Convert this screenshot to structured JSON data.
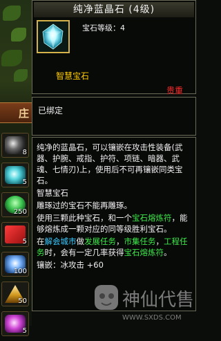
{
  "colors": {
    "title_bg": "#2a2a22",
    "border": "#6b6b5a",
    "gold_label": "#ffcc00",
    "rarity_red": "#ff2a2a",
    "highlight_green": "#3ee84a",
    "warning_red": "#ff3030",
    "link_cyan": "#37c9ff"
  },
  "left_panel": {
    "tab_label": "庄",
    "slots": [
      {
        "icon": "black-crystal-icon",
        "count": "8"
      },
      {
        "icon": "cyan-crystal-icon",
        "count": "5"
      },
      {
        "icon": "green-jade-icon",
        "count": "250"
      },
      {
        "icon": "red-box-icon",
        "count": "5"
      },
      {
        "icon": "blue-gem-icon",
        "count": "100"
      },
      {
        "icon": "gold-pyramid-icon",
        "count": "50"
      },
      {
        "icon": "magenta-crystal-icon",
        "count": "5"
      }
    ]
  },
  "tooltip": {
    "title": "纯净蓝晶石 (4级)",
    "gem_icon": "blue-crystal-gem-icon",
    "gem_level_label": "宝石等级：4",
    "gem_name": "智慧宝石",
    "rarity": "贵重",
    "bound_status": "已绑定",
    "desc_line1": "纯净的蓝晶石，可以镶嵌在攻击性装备(武器、护腕、戒指、护符、项链、暗器、武魂、七情刃)上，使用后不可再镶嵌同类宝石。",
    "gem_type": "智慧宝石",
    "warning": "雕琢过的宝石不能再雕琢。",
    "fusion_pre": "使用三颗此种宝石，和一个",
    "fusion_item": "宝石熔炼符",
    "fusion_post": "，能够熔炼成一颗对应的同等级胜利宝石。",
    "quest_pre": "在",
    "quest_city": "解会城市",
    "quest_mid1": "做",
    "quest_dev": "发展任务",
    "quest_mid2": "，",
    "quest_market": "市集任务",
    "quest_mid3": "，",
    "quest_engineering": "工程任务",
    "quest_post": "时，会有一定几率获得",
    "quest_item": "宝石熔炼符",
    "quest_end": "。",
    "inlay_effect": "镶嵌：冰攻击 +60"
  },
  "watermark": {
    "brand_text": "神仙代售",
    "site_text": "WWW.SXDS.COM"
  }
}
